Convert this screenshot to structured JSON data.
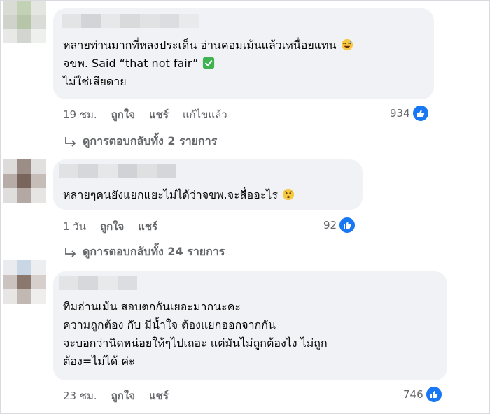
{
  "comments": [
    {
      "lines": [
        "หลายท่านมากที่หลงประเด็น อ่านคอมเม้นแล้วเหนื่อยแทน",
        "จขพ. Said “that not fair”",
        "ไม่ใช่เสียดาย"
      ],
      "time": "19 ชม.",
      "like_label": "ถูกใจ",
      "share_label": "แชร์",
      "edited_label": "แก้ไขแล้ว",
      "reaction_count": "934",
      "replies_label": "ดูการตอบกลับทั้ง 2 รายการ"
    },
    {
      "lines": [
        "หลายๆคนยังแยกแยะไม่ได้ว่าจขพ.จะสื่ออะไร"
      ],
      "time": "1 วัน",
      "like_label": "ถูกใจ",
      "share_label": "แชร์",
      "reaction_count": "92",
      "replies_label": "ดูการตอบกลับทั้ง 24 รายการ"
    },
    {
      "lines": [
        "ทีมอ่านเม้น สอบตกกันเยอะมากนะคะ",
        "ความถูกต้อง กับ มีน้ำใจ ต้องแยกออกจากกัน",
        "จะบอกว่านิดหน่อยให้ๆไปเถอะ แต่มันไม่ถูกต้องไง ไม่ถูก",
        "ต้อง=ไม่ได้ ค่ะ"
      ],
      "time": "23 ชม.",
      "like_label": "ถูกใจ",
      "share_label": "แชร์",
      "reaction_count": "746"
    }
  ],
  "colors": {
    "bubble": "#f0f2f5",
    "meta": "#65676b",
    "like_blue": "#1877f2"
  },
  "icons": [
    "laugh-sweat-emoji",
    "check-mark-emoji",
    "worried-face-emoji",
    "like-icon",
    "reply-arrow-icon"
  ]
}
